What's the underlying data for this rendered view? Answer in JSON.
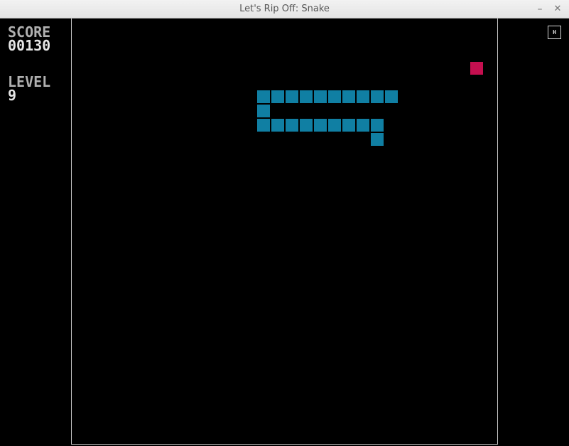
{
  "window": {
    "title": "Let's Rip Off: Snake",
    "minimize_glyph": "–",
    "close_glyph": "✕"
  },
  "hud": {
    "score_label": "SCORE",
    "score_value": "00130",
    "level_label": "LEVEL",
    "level_value": "9",
    "help_glyph": "H"
  },
  "colors": {
    "snake": "#107fa3",
    "food": "#c40f4f",
    "background": "#000000",
    "border": "#c8c8c8"
  },
  "grid": {
    "cols": 30,
    "rows": 30
  },
  "snake": [
    [
      22,
      5
    ],
    [
      21,
      5
    ],
    [
      20,
      5
    ],
    [
      19,
      5
    ],
    [
      18,
      5
    ],
    [
      17,
      5
    ],
    [
      16,
      5
    ],
    [
      15,
      5
    ],
    [
      14,
      5
    ],
    [
      13,
      5
    ],
    [
      13,
      6
    ],
    [
      13,
      7
    ],
    [
      14,
      7
    ],
    [
      15,
      7
    ],
    [
      16,
      7
    ],
    [
      17,
      7
    ],
    [
      18,
      7
    ],
    [
      19,
      7
    ],
    [
      20,
      7
    ],
    [
      21,
      7
    ],
    [
      21,
      8
    ]
  ],
  "food": [
    28,
    3
  ]
}
